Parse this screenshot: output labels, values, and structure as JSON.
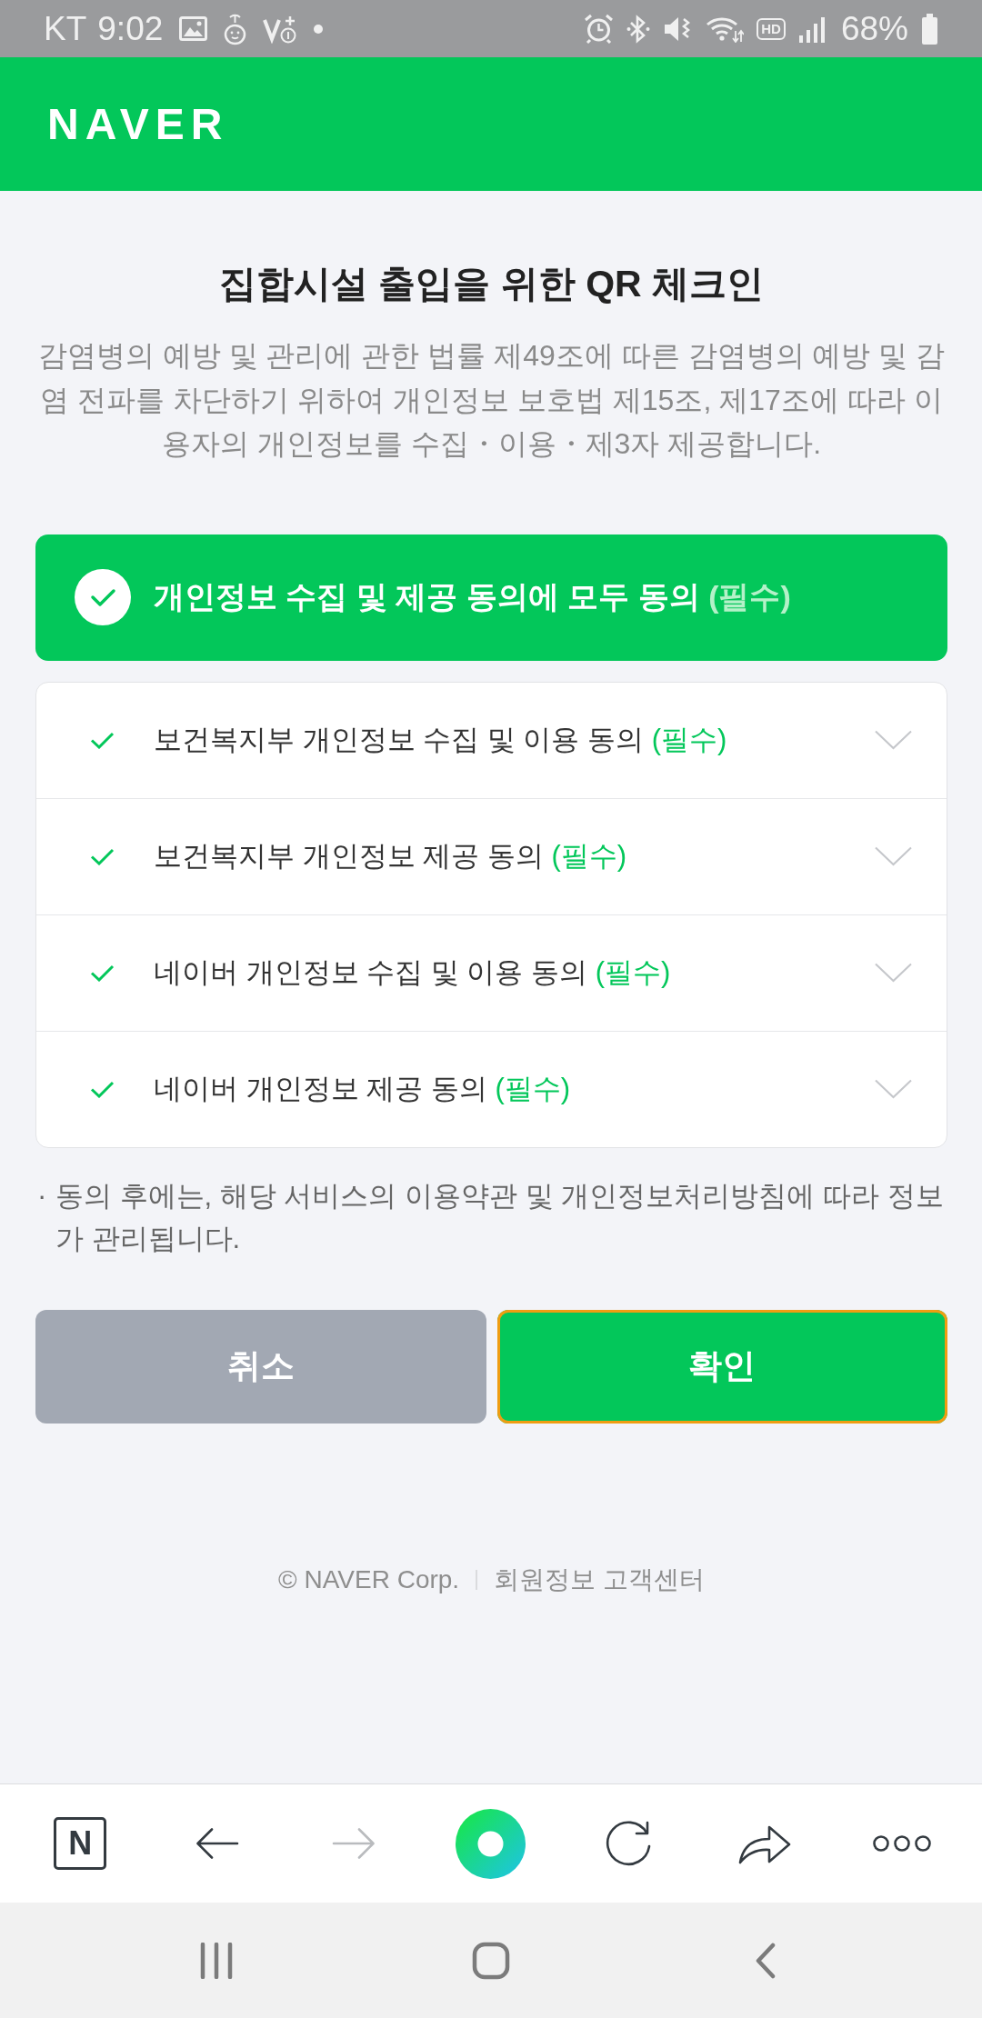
{
  "status_bar": {
    "carrier": "KT",
    "time": "9:02",
    "hd_label": "HD",
    "battery": "68%"
  },
  "header": {
    "logo": "NAVER"
  },
  "intro": {
    "title": "집합시설 출입을 위한 QR 체크인",
    "description": "감염병의 예방 및 관리에 관한 법률 제49조에 따른 감염병의 예방 및 감염 전파를 차단하기 위하여 개인정보 보호법 제15조, 제17조에 따라 이용자의 개인정보를 수집・이용・제3자 제공합니다."
  },
  "agree_all": {
    "label": "개인정보 수집 및 제공 동의에 모두 동의",
    "tag": "(필수)",
    "checked": true
  },
  "consents": [
    {
      "label": "보건복지부 개인정보 수집 및 이용 동의",
      "tag": "(필수)",
      "checked": true,
      "expanded": false
    },
    {
      "label": "보건복지부 개인정보 제공 동의",
      "tag": "(필수)",
      "checked": true,
      "expanded": false
    },
    {
      "label": "네이버 개인정보 수집 및 이용 동의",
      "tag": "(필수)",
      "checked": true,
      "expanded": false
    },
    {
      "label": "네이버 개인정보 제공 동의",
      "tag": "(필수)",
      "checked": true,
      "expanded": false
    }
  ],
  "note": {
    "bullet": "·",
    "text": "동의 후에는, 해당 서비스의 이용약관 및 개인정보처리방침에 따라 정보가 관리됩니다."
  },
  "buttons": [
    {
      "kind": "cancel",
      "label": "취소",
      "focused": false
    },
    {
      "kind": "confirm",
      "label": "확인",
      "focused": true
    }
  ],
  "footer": {
    "copyright": "© NAVER Corp.",
    "link": "회원정보 고객센터"
  },
  "browser_toolbar": [
    {
      "kind": "logo",
      "label": "N",
      "disabled": false
    },
    {
      "kind": "back",
      "disabled": false
    },
    {
      "kind": "forward",
      "disabled": true
    },
    {
      "kind": "ring",
      "disabled": false
    },
    {
      "kind": "reload",
      "disabled": false
    },
    {
      "kind": "share",
      "disabled": false
    },
    {
      "kind": "more",
      "disabled": false
    }
  ]
}
